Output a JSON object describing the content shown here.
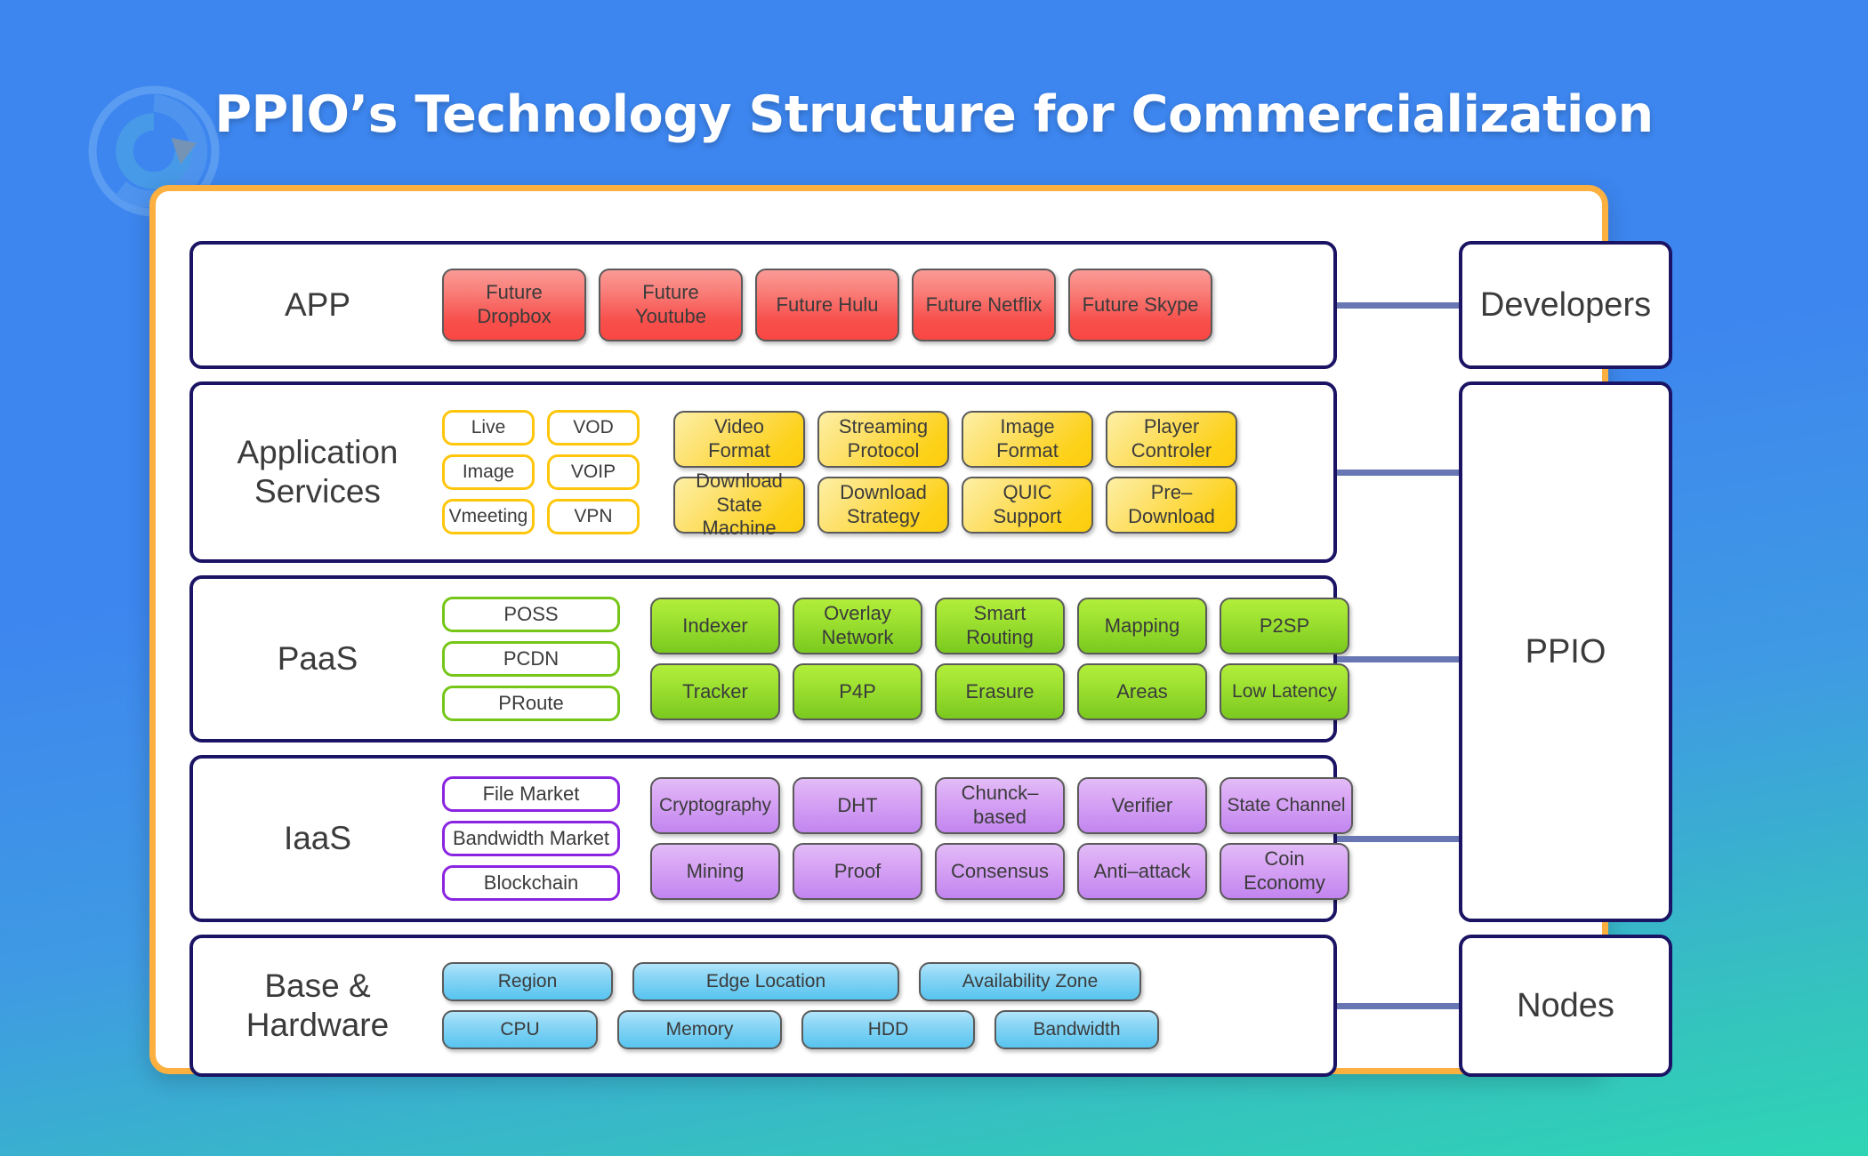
{
  "title": "PPIO’s Technology Structure for Commercialization",
  "logo": {
    "icon": "ppio-logo-icon"
  },
  "colors": {
    "background_top": "#3d86ef",
    "background_bottom": "#2ed5b4",
    "card_border": "#fbb040",
    "row_border": "#1b1464",
    "connector": "#6877b4",
    "app_chip": "#f8504c",
    "services_chip": "#fdd21c",
    "paas_chip": "#a0e332",
    "iaas_chip": "#d9a7f5",
    "hardware_chip": "#8fd8f6"
  },
  "layers": [
    {
      "id": "app",
      "label": "APP",
      "style": "red",
      "items": [
        "Future Dropbox",
        "Future Youtube",
        "Future Hulu",
        "Future Netflix",
        "Future Skype"
      ]
    },
    {
      "id": "application-services",
      "label": "Application\nServices",
      "style": "yellow",
      "outline_items": [
        "Live",
        "VOD",
        "Image",
        "VOIP",
        "Vmeeting",
        "VPN"
      ],
      "grid_rows": [
        [
          "Video\nFormat",
          "Streaming\nProtocol",
          "Image\nFormat",
          "Player\nControler"
        ],
        [
          "Download\nState Machine",
          "Download\nStrategy",
          "QUIC\nSupport",
          "Pre–\nDownload"
        ]
      ]
    },
    {
      "id": "paas",
      "label": "PaaS",
      "style": "green",
      "outline_items": [
        "POSS",
        "PCDN",
        "PRoute"
      ],
      "grid_rows": [
        [
          "Indexer",
          "Overlay\nNetwork",
          "Smart\nRouting",
          "Mapping",
          "P2SP"
        ],
        [
          "Tracker",
          "P4P",
          "Erasure",
          "Areas",
          "Low Latency"
        ]
      ]
    },
    {
      "id": "iaas",
      "label": "IaaS",
      "style": "purple",
      "outline_items": [
        "File Market",
        "Bandwidth Market",
        "Blockchain"
      ],
      "grid_rows": [
        [
          "Cryptography",
          "DHT",
          "Chunck–\nbased",
          "Verifier",
          "State Channel"
        ],
        [
          "Mining",
          "Proof",
          "Consensus",
          "Anti–attack",
          "Coin\nEconomy"
        ]
      ]
    },
    {
      "id": "base-hardware",
      "label": "Base &\nHardware",
      "style": "blue",
      "grid_rows": [
        [
          "Region",
          "Edge Location",
          "Availability Zone"
        ],
        [
          "CPU",
          "Memory",
          "HDD",
          "Bandwidth"
        ]
      ]
    }
  ],
  "actors": [
    {
      "id": "developers",
      "label": "Developers"
    },
    {
      "id": "ppio",
      "label": "PPIO"
    },
    {
      "id": "nodes",
      "label": "Nodes"
    }
  ]
}
